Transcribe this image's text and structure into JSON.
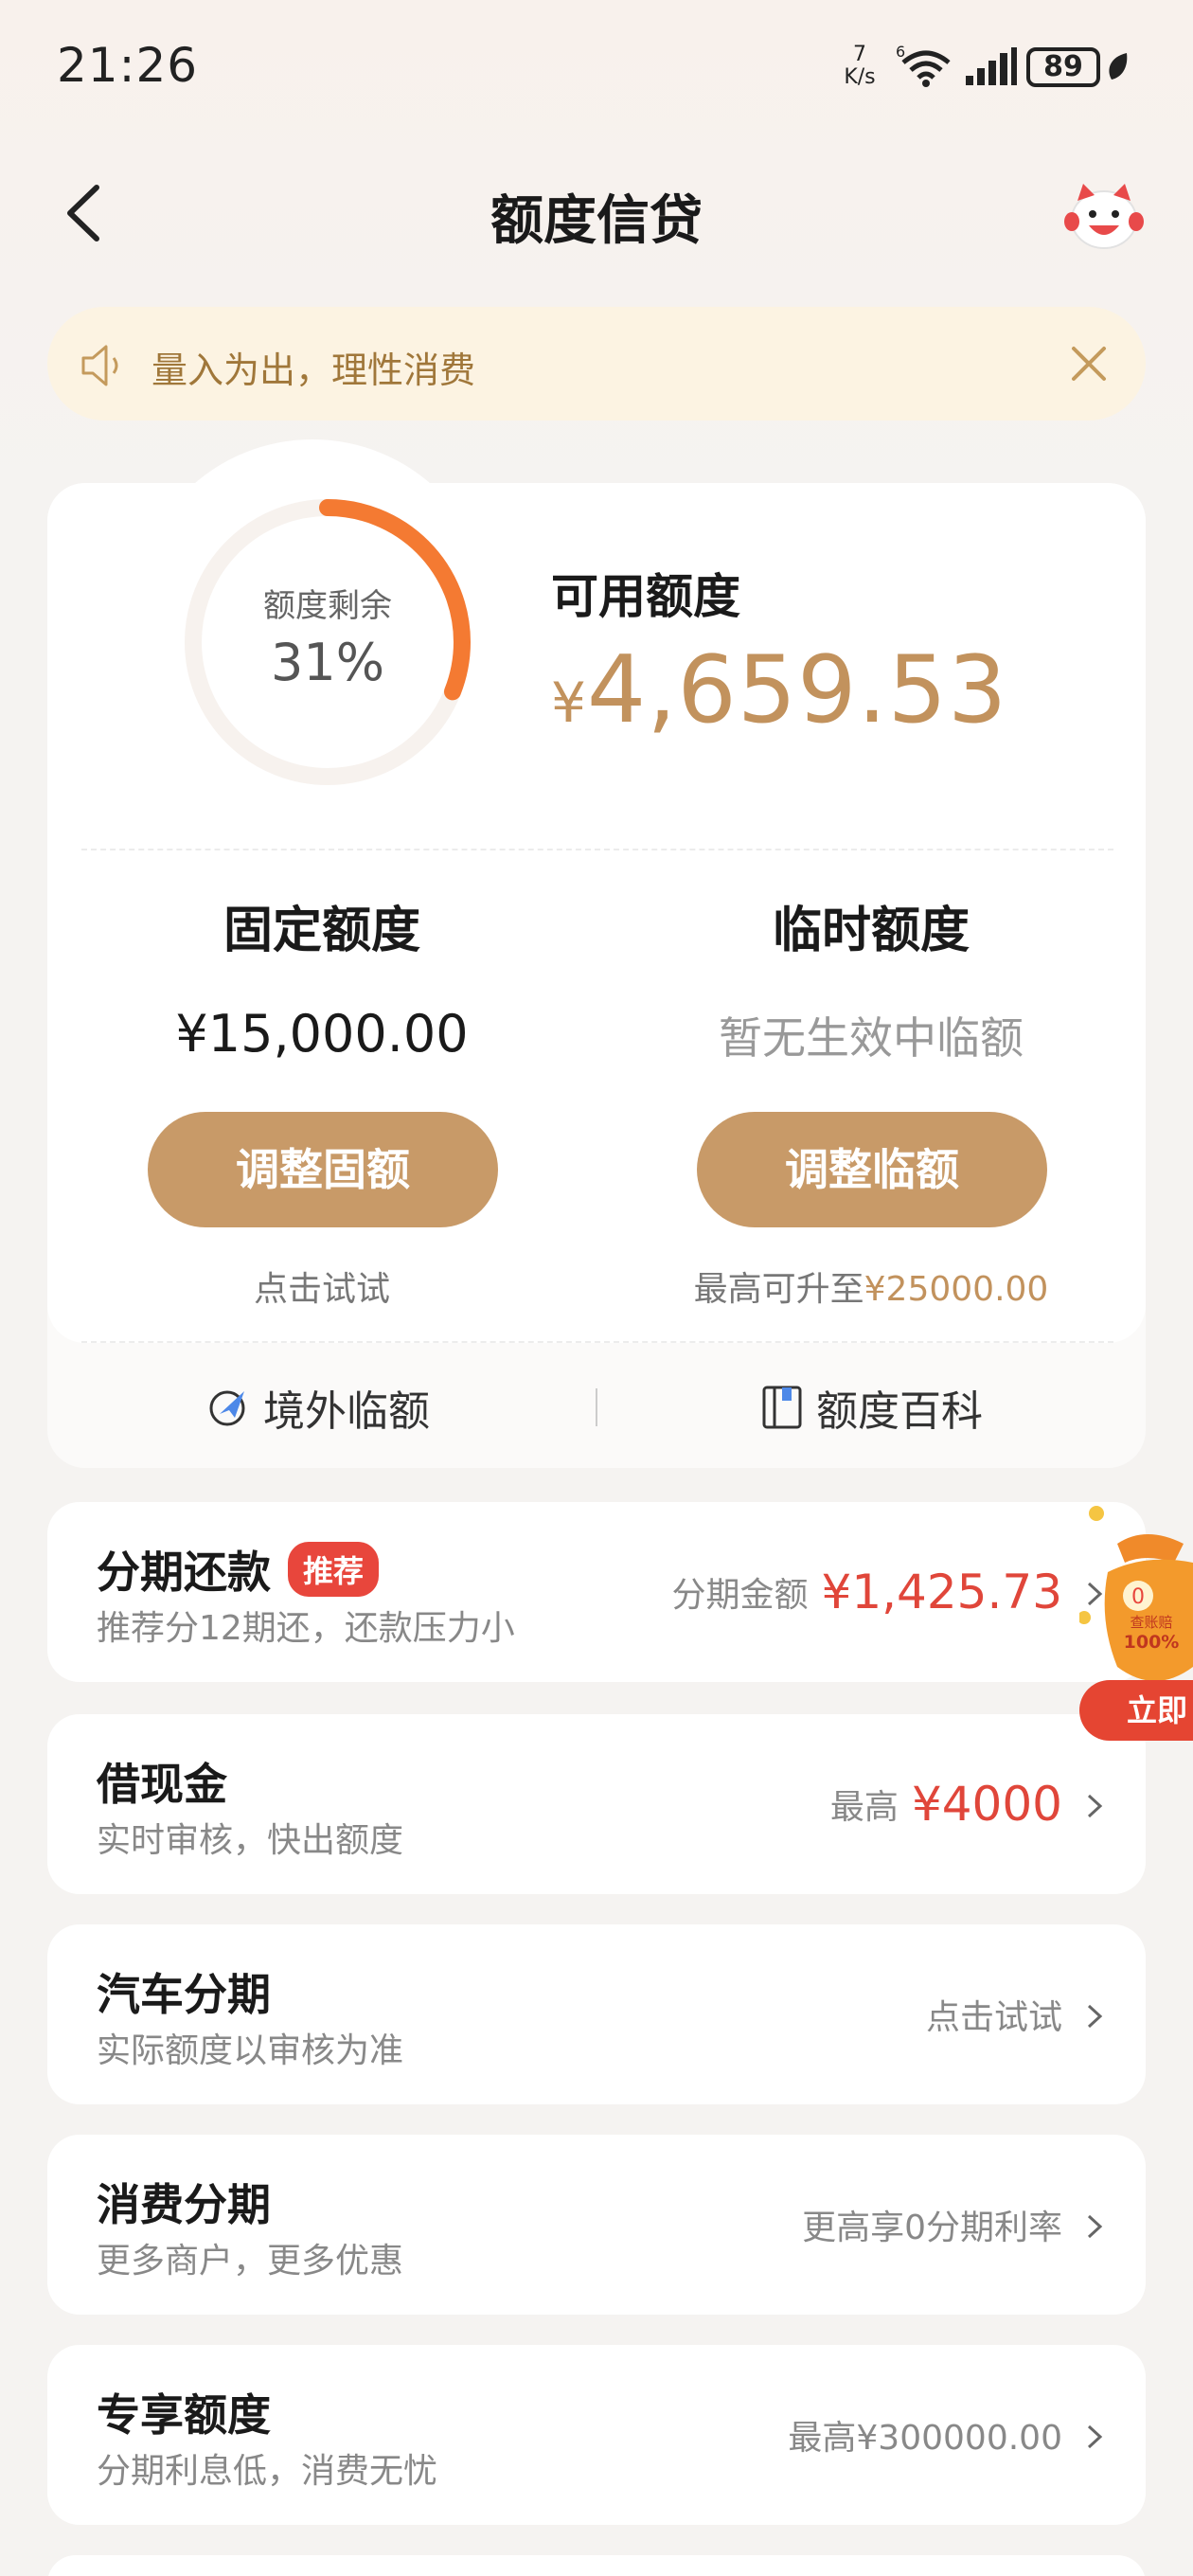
{
  "status_bar": {
    "time": "21:26",
    "net_speed_value": "7",
    "net_speed_unit": "K/s",
    "wifi_badge": "6",
    "battery": "89"
  },
  "header": {
    "title": "额度信贷"
  },
  "notice": {
    "text": "量入为出，理性消费"
  },
  "credit": {
    "gauge_label": "额度剩余",
    "gauge_value": "31%",
    "gauge_fraction": 0.31,
    "available_label": "可用额度",
    "available_currency": "¥",
    "available_amount": "4,659.53",
    "fixed_title": "固定额度",
    "fixed_amount": "¥15,000.00",
    "fixed_button": "调整固额",
    "fixed_hint": "点击试试",
    "temp_title": "临时额度",
    "temp_status": "暂无生效中临额",
    "temp_button": "调整临额",
    "temp_hint_prefix": "最高可升至",
    "temp_hint_amount": "¥25000.00",
    "link_overseas": "境外临额",
    "link_wiki": "额度百科"
  },
  "services": [
    {
      "title": "分期还款",
      "tag": "推荐",
      "subtitle": "推荐分12期还，还款压力小",
      "right_label": "分期金额",
      "right_value": "¥1,425.73"
    },
    {
      "title": "借现金",
      "subtitle": "实时审核，快出额度",
      "right_label": "最高",
      "right_value": "¥4000"
    },
    {
      "title": "汽车分期",
      "subtitle": "实际额度以审核为准",
      "right_label": "点击试试"
    },
    {
      "title": "消费分期",
      "subtitle": "更多商户，更多优惠",
      "right_label": "更高享0分期利率"
    },
    {
      "title": "专享额度",
      "subtitle": "分期利息低，消费无忧",
      "right_label": "最高¥300000.00"
    }
  ],
  "promo": {
    "badge": "0",
    "line1": "查账赔",
    "line2": "100%",
    "button": "立即"
  },
  "colors": {
    "accent_gold": "#c89a68",
    "gauge_orange": "#f47a32",
    "price_red": "#e0463a",
    "notice_bg": "#fcf3e2"
  }
}
